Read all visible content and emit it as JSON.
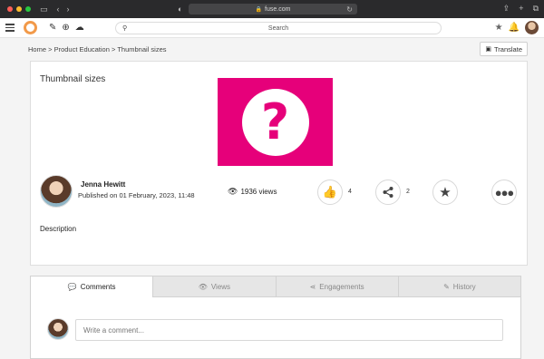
{
  "browser": {
    "url": "fuse.com",
    "traffic_light_colors": [
      "#ff5f57",
      "#febc2e",
      "#28c840"
    ]
  },
  "header": {
    "search_placeholder": "Search",
    "brand_color": "#f29a4a"
  },
  "breadcrumb": {
    "items": [
      "Home",
      "Product Education",
      "Thumbnail sizes"
    ],
    "separator": ">"
  },
  "translate_label": "Translate",
  "post": {
    "title": "Thumbnail sizes",
    "thumbnail_color": "#e6007a",
    "thumbnail_glyph": "?",
    "author": "Jenna Hewitt",
    "published": "Published on 01 February, 2023, 11:48",
    "views": "1936 views",
    "likes": "4",
    "shares": "2",
    "description_label": "Description"
  },
  "tabs": [
    {
      "label": "Comments",
      "icon": "comment-icon",
      "active": true
    },
    {
      "label": "Views",
      "icon": "eye-icon",
      "active": false
    },
    {
      "label": "Engagements",
      "icon": "share-icon",
      "active": false
    },
    {
      "label": "History",
      "icon": "pencil-icon",
      "active": false
    }
  ],
  "comment": {
    "placeholder": "Write a comment..."
  }
}
